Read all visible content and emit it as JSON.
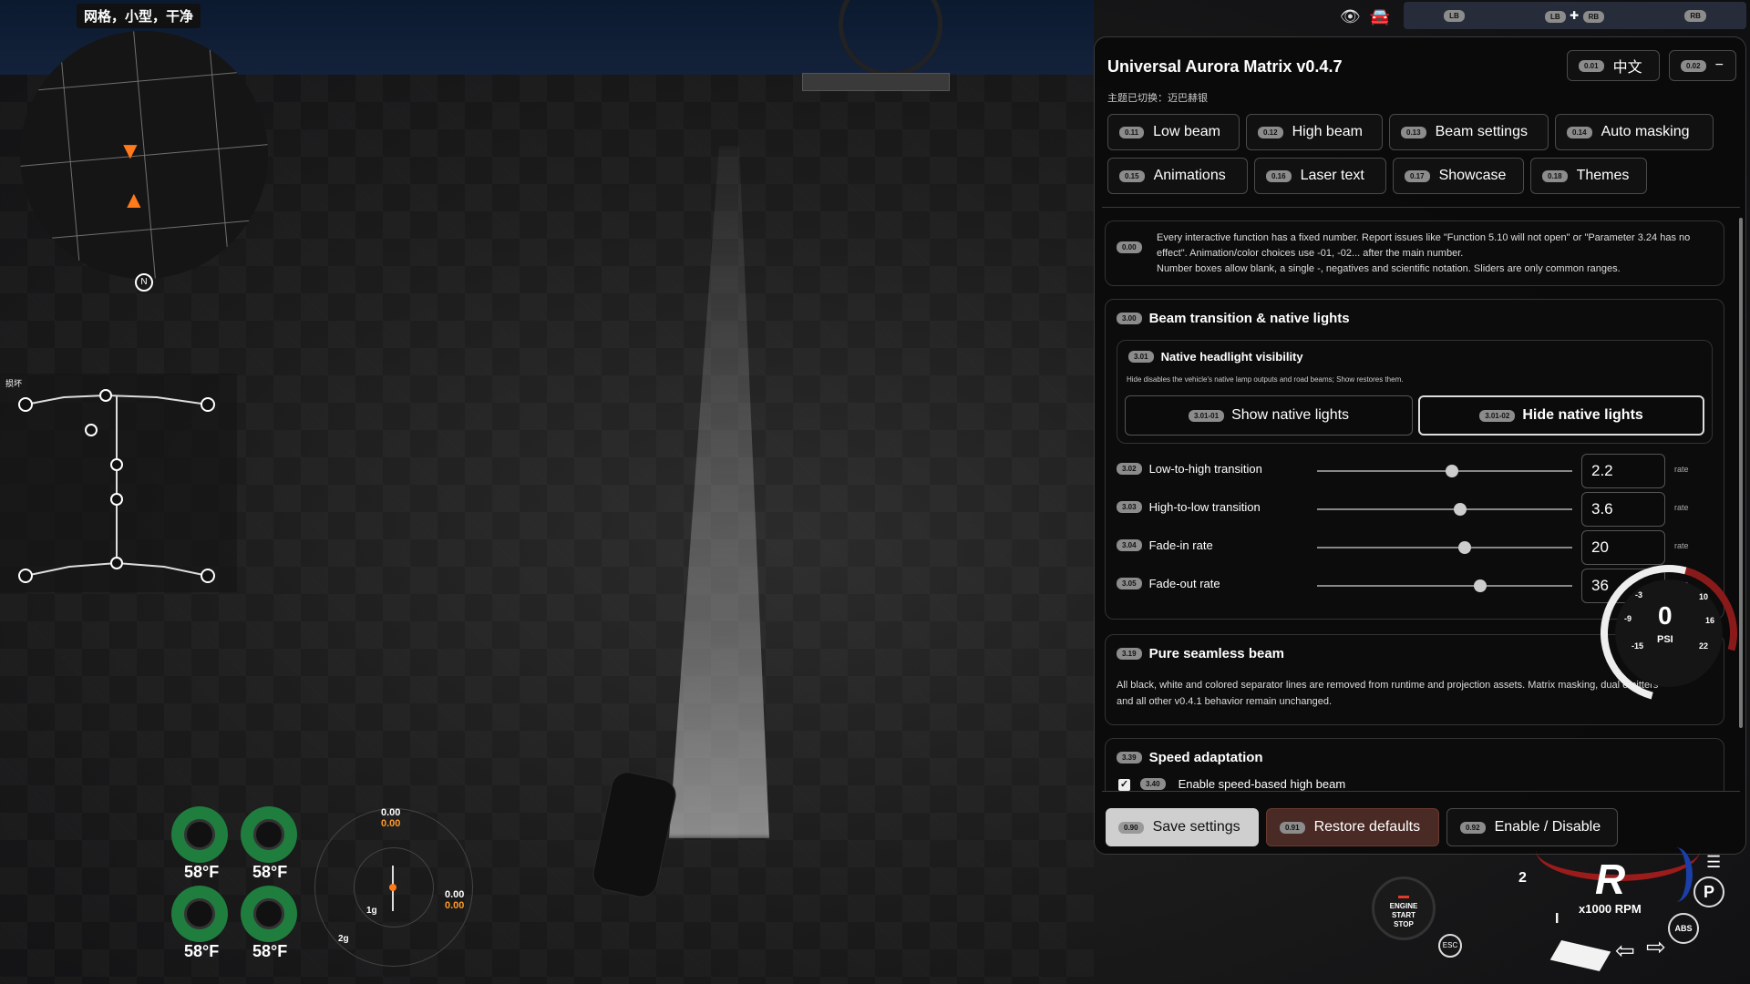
{
  "minimap": {
    "label": "网格，小型，干净",
    "north": "N"
  },
  "skeleton": {
    "label": "损坏"
  },
  "tires": [
    {
      "temp": "58°F"
    },
    {
      "temp": "58°F"
    },
    {
      "temp": "58°F"
    },
    {
      "temp": "58°F"
    }
  ],
  "gmeter": {
    "top_white": "0.00",
    "top_orange": "0.00",
    "right_white": "0.00",
    "right_orange": "0.00",
    "ring1": "1g",
    "ring2": "2g"
  },
  "top_bar": {
    "tab1": "LB",
    "tab2": "LB",
    "tab2_plus": "✚",
    "tab3": "RB",
    "tab4": "RB"
  },
  "panel": {
    "title": "Universal Aurora Matrix v0.4.7",
    "subtitle": "主题已切换：迈巴赫银",
    "lang": {
      "chip": "0.01",
      "label": "中文"
    },
    "minimize": {
      "chip": "0.02",
      "label": "−"
    },
    "tabs": [
      {
        "chip": "0.11",
        "label": "Low beam"
      },
      {
        "chip": "0.12",
        "label": "High beam"
      },
      {
        "chip": "0.13",
        "label": "Beam settings"
      },
      {
        "chip": "0.14",
        "label": "Auto masking"
      },
      {
        "chip": "0.15",
        "label": "Animations"
      },
      {
        "chip": "0.16",
        "label": "Laser text"
      },
      {
        "chip": "0.17",
        "label": "Showcase"
      },
      {
        "chip": "0.18",
        "label": "Themes"
      }
    ],
    "note": {
      "chip": "0.00",
      "line1": "Every interactive function has a fixed number. Report issues like \"Function 5.10 will not open\" or \"Parameter 3.24 has no",
      "line2": "effect\". Animation/color choices use -01, -02... after the main number.",
      "line3": "Number boxes allow blank, a single -, negatives and scientific notation. Sliders are only common ranges."
    },
    "beam_section": {
      "chip": "3.00",
      "title": "Beam transition & native lights",
      "visibility": {
        "chip": "3.01",
        "title": "Native headlight visibility",
        "desc": "Hide disables the vehicle's native lamp outputs and road beams; Show restores them.",
        "show": {
          "chip": "3.01-01",
          "label": "Show native lights"
        },
        "hide": {
          "chip": "3.01-02",
          "label": "Hide native lights"
        }
      },
      "rows": [
        {
          "chip": "3.02",
          "label": "Low-to-high transition",
          "value": "2.2",
          "unit": "rate",
          "slider": 0.53
        },
        {
          "chip": "3.03",
          "label": "High-to-low transition",
          "value": "3.6",
          "unit": "rate",
          "slider": 0.56
        },
        {
          "chip": "3.04",
          "label": "Fade-in rate",
          "value": "20",
          "unit": "rate",
          "slider": 0.58
        },
        {
          "chip": "3.05",
          "label": "Fade-out rate",
          "value": "36",
          "unit": "rate",
          "slider": 0.64
        }
      ]
    },
    "seamless": {
      "chip": "3.19",
      "title": "Pure seamless beam",
      "line1": "All black, white and colored separator lines are removed from runtime and projection assets. Matrix masking, dual emitters",
      "line2": "and all other v0.4.1 behavior remain unchanged."
    },
    "speed": {
      "chip": "3.39",
      "title": "Speed adaptation",
      "check_chip": "3.40",
      "check_label": "Enable speed-based high beam",
      "checked": true
    },
    "footer": [
      {
        "chip": "0.90",
        "label": "Save settings"
      },
      {
        "chip": "0.91",
        "label": "Restore defaults"
      },
      {
        "chip": "0.92",
        "label": "Enable / Disable"
      }
    ]
  },
  "psi_gauge": {
    "value": "0",
    "unit": "PSI",
    "ticks": [
      "-3",
      "-9",
      "-15",
      "10",
      "16",
      "22"
    ]
  },
  "dash": {
    "startstop": [
      "ENGINE",
      "START",
      "STOP"
    ],
    "esc": "ESC",
    "gear": "R",
    "rpm_label": "x1000 RPM",
    "tick2": "2",
    "tick1": "I",
    "park": "P",
    "abs": "ABS"
  },
  "colors": {
    "tire_ok": "#1f7d3e",
    "accent_orange": "#ff9a2a",
    "restore_btn": "#4a2a24"
  }
}
